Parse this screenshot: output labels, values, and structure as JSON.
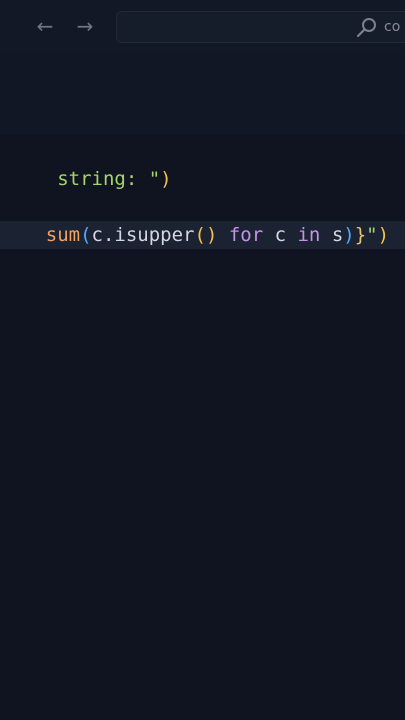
{
  "titlebar": {
    "back_icon": "←",
    "forward_icon": "→",
    "command_center": {
      "search_icon": "search-icon",
      "text": "co"
    }
  },
  "editor": {
    "lines": [
      {
        "parts": [
          {
            "text": " string: ",
            "kind": "string"
          },
          {
            "text": "\"",
            "kind": "string"
          },
          {
            "text": ")",
            "kind": "punc"
          }
        ]
      },
      {
        "parts": [
          {
            "text": "sum",
            "kind": "fn"
          },
          {
            "text": "(",
            "kind": "paren"
          },
          {
            "text": "c.isupper",
            "kind": "var"
          },
          {
            "text": "()",
            "kind": "punc"
          },
          {
            "text": " for",
            "kind": "kw"
          },
          {
            "text": " c ",
            "kind": "var"
          },
          {
            "text": "in",
            "kind": "kw"
          },
          {
            "text": " s",
            "kind": "var"
          },
          {
            "text": ")",
            "kind": "paren"
          },
          {
            "text": "}",
            "kind": "brace"
          },
          {
            "text": "\"",
            "kind": "string"
          },
          {
            "text": ")",
            "kind": "punc"
          }
        ]
      }
    ]
  },
  "colors": {
    "background": "#0f1420",
    "titlebar": "#121826",
    "line_highlight": "#1b2231"
  }
}
